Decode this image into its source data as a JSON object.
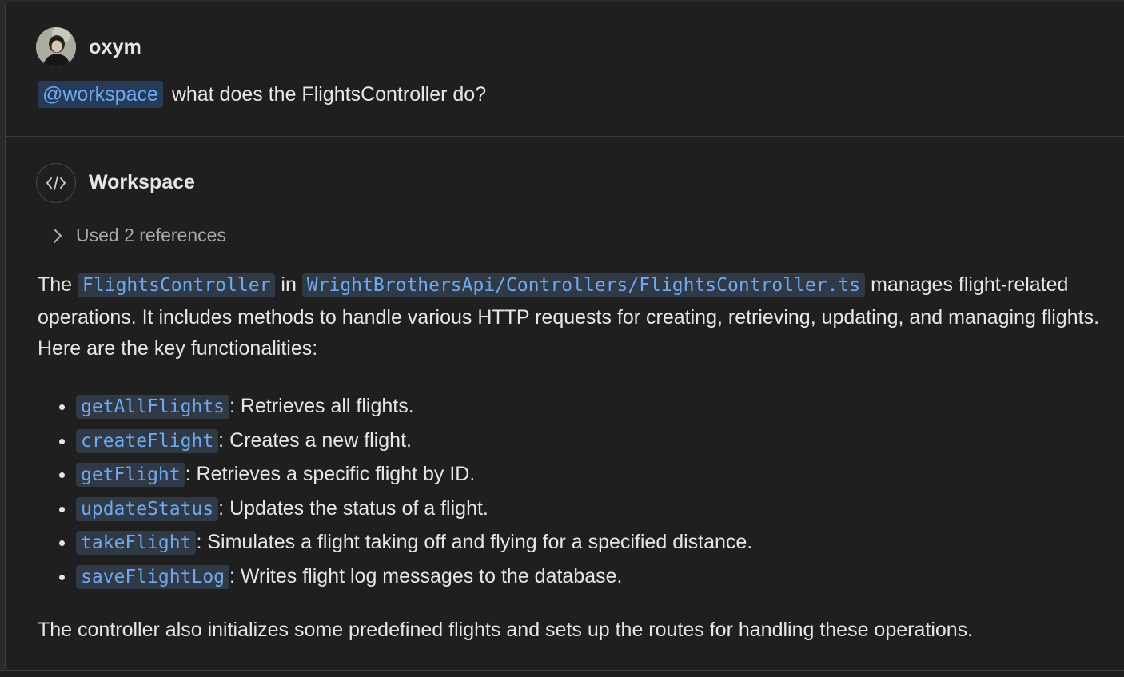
{
  "request": {
    "username": "oxym",
    "mention": "@workspace",
    "question": " what does the FlightsController do?"
  },
  "response": {
    "agent_name": "Workspace",
    "references_label": "Used 2 references",
    "intro": {
      "part1": "The ",
      "code1": "FlightsController",
      "part2": " in ",
      "code2": "WrightBrothersApi/Controllers/FlightsController.ts",
      "part3": " manages flight-related operations. It includes methods to handle various HTTP requests for creating, retrieving, updating, and managing flights. Here are the key functionalities:"
    },
    "functions": [
      {
        "name": "getAllFlights",
        "desc": ": Retrieves all flights."
      },
      {
        "name": "createFlight",
        "desc": ": Creates a new flight."
      },
      {
        "name": "getFlight",
        "desc": ": Retrieves a specific flight by ID."
      },
      {
        "name": "updateStatus",
        "desc": ": Updates the status of a flight."
      },
      {
        "name": "takeFlight",
        "desc": ": Simulates a flight taking off and flying for a specified distance."
      },
      {
        "name": "saveFlightLog",
        "desc": ": Writes flight log messages to the database."
      }
    ],
    "outro": "The controller also initializes some predefined flights and sets up the routes for handling these operations."
  },
  "colors": {
    "background": "#1f1f1f",
    "code_background": "#303a47",
    "code_text": "#6fa8ec",
    "mention_background": "#263b57"
  }
}
